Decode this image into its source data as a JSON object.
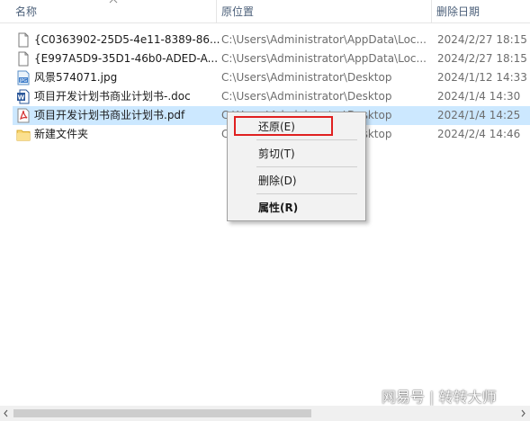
{
  "header": {
    "col_name": "名称",
    "col_original_location": "原位置",
    "col_date_deleted": "删除日期"
  },
  "files": [
    {
      "name": "{C0363902-25D5-4e11-8389-86...",
      "location": "C:\\Users\\Administrator\\AppData\\Loc...",
      "date": "2024/2/27 18:15",
      "icon": "blank-file-icon"
    },
    {
      "name": "{E997A5D9-35D1-46b0-ADED-A...",
      "location": "C:\\Users\\Administrator\\AppData\\Loc...",
      "date": "2024/2/27 18:15",
      "icon": "blank-file-icon"
    },
    {
      "name": "风景574071.jpg",
      "location": "C:\\Users\\Administrator\\Desktop",
      "date": "2024/1/12 14:33",
      "icon": "jpg-file-icon"
    },
    {
      "name": "项目开发计划书商业计划书-.doc",
      "location": "C:\\Users\\Administrator\\Desktop",
      "date": "2024/1/4 14:30",
      "icon": "word-file-icon"
    },
    {
      "name": "项目开发计划书商业计划书.pdf",
      "location": "C:\\Users\\Administrator\\Desktop",
      "date": "2024/1/4 14:25",
      "icon": "pdf-file-icon"
    },
    {
      "name": "新建文件夹",
      "location": "C:\\Users\\Administrator\\Desktop",
      "date": "2024/2/4 14:46",
      "icon": "folder-icon"
    }
  ],
  "context_menu": {
    "restore": "还原(E)",
    "cut": "剪切(T)",
    "delete": "删除(D)",
    "properties": "属性(R)"
  },
  "watermark": "网易号 | 转转大师",
  "colors": {
    "selection": "#cce8ff",
    "highlight_box": "#e02020",
    "header_text": "#4c607a"
  }
}
